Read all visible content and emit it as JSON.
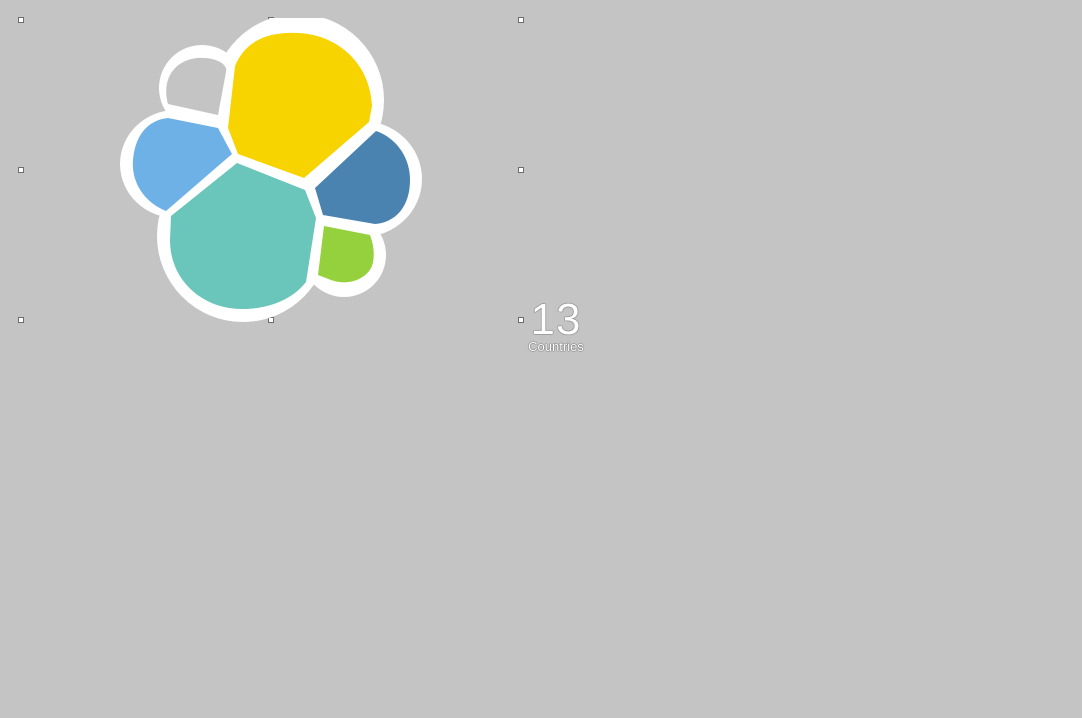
{
  "workpad": {
    "logo": {
      "icon": "elastic-logo-icon",
      "colors": {
        "outline": "#ffffff",
        "yellow": "#f7d300",
        "light_blue": "#6db1e6",
        "teal": "#6ac5bb",
        "dark_blue": "#4a82b0",
        "green": "#95d13d"
      }
    },
    "metric": {
      "value": "13",
      "label": "Countries"
    },
    "colors": {
      "background": "#c4c4c4",
      "metric_text": "#ffffff"
    }
  }
}
